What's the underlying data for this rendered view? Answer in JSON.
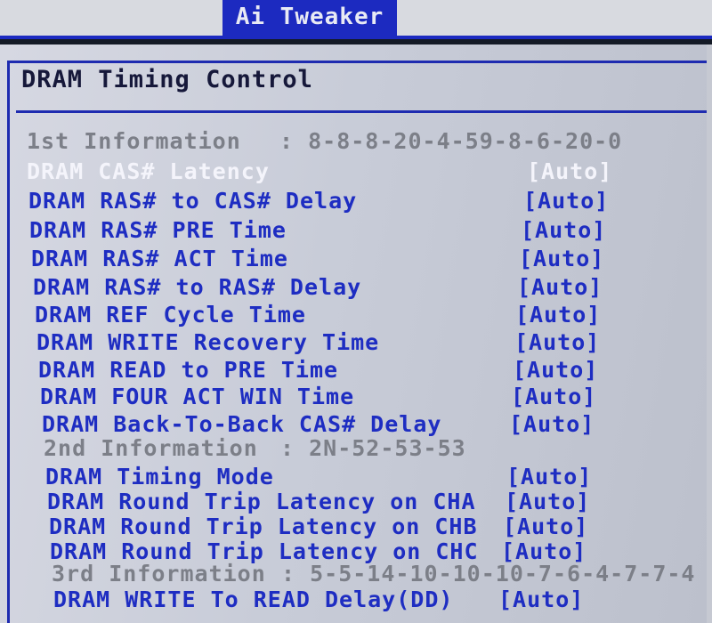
{
  "header": {
    "title": "Ai Tweaker"
  },
  "section": {
    "title": "DRAM Timing Control"
  },
  "rows": [
    {
      "kind": "info",
      "label": "1st Information",
      "value": ": 8-8-8-20-4-59-8-6-20-0"
    },
    {
      "kind": "item",
      "label": "DRAM CAS# Latency",
      "value": "[Auto]",
      "selected": true
    },
    {
      "kind": "item",
      "label": "DRAM RAS# to CAS# Delay",
      "value": "[Auto]"
    },
    {
      "kind": "item",
      "label": "DRAM RAS# PRE Time",
      "value": "[Auto]"
    },
    {
      "kind": "item",
      "label": "DRAM RAS# ACT Time",
      "value": "[Auto]"
    },
    {
      "kind": "item",
      "label": "DRAM RAS# to RAS# Delay",
      "value": "[Auto]"
    },
    {
      "kind": "item",
      "label": "DRAM REF Cycle Time",
      "value": "[Auto]"
    },
    {
      "kind": "item",
      "label": "DRAM WRITE Recovery Time",
      "value": "[Auto]"
    },
    {
      "kind": "item",
      "label": "DRAM READ to PRE Time",
      "value": "[Auto]"
    },
    {
      "kind": "item",
      "label": "DRAM FOUR ACT WIN Time",
      "value": "[Auto]"
    },
    {
      "kind": "item",
      "label": "DRAM Back-To-Back CAS# Delay",
      "value": "[Auto]"
    },
    {
      "kind": "info",
      "label": "2nd Information",
      "value": ": 2N-52-53-53"
    },
    {
      "kind": "item",
      "label": "DRAM Timing Mode",
      "value": "[Auto]"
    },
    {
      "kind": "item",
      "label": "DRAM Round Trip Latency on CHA",
      "value": "[Auto]"
    },
    {
      "kind": "item",
      "label": "DRAM Round Trip Latency on CHB",
      "value": "[Auto]"
    },
    {
      "kind": "item",
      "label": "DRAM Round Trip Latency on CHC",
      "value": "[Auto]"
    },
    {
      "kind": "info",
      "label": "3rd Information",
      "value": ": 5-5-14-10-10-10-7-6-4-7-7-4"
    },
    {
      "kind": "item",
      "label": "DRAM WRITE To READ Delay(DD)",
      "value": "[Auto]"
    }
  ]
}
